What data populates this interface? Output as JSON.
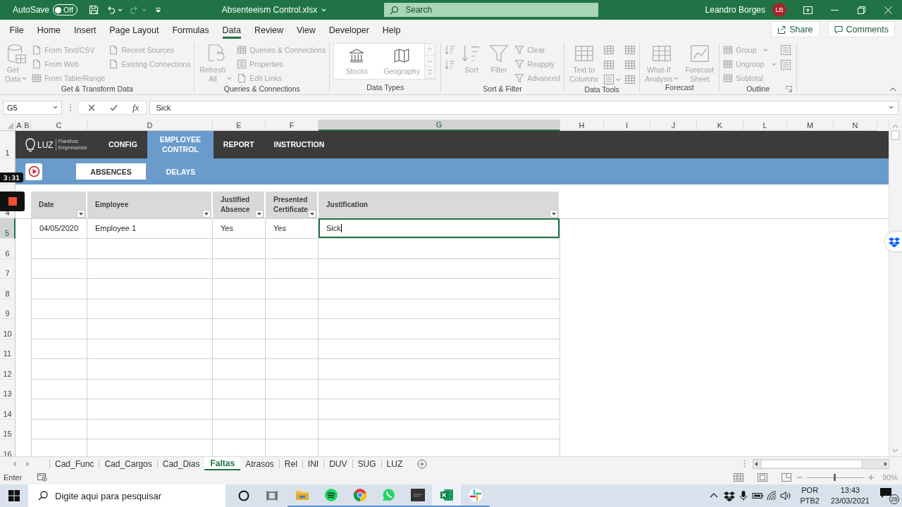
{
  "title_bar": {
    "autosave": {
      "label": "AutoSave",
      "state_text": "Off",
      "on": false
    },
    "file_name": "Absenteeism Control.xlsx",
    "search": {
      "placeholder": "Search"
    },
    "user": {
      "name": "Leandro Borges",
      "initials": "LB"
    }
  },
  "ribbon_tabs": [
    {
      "label": "File",
      "selected": false
    },
    {
      "label": "Home",
      "selected": false
    },
    {
      "label": "Insert",
      "selected": false
    },
    {
      "label": "Page Layout",
      "selected": false
    },
    {
      "label": "Formulas",
      "selected": false
    },
    {
      "label": "Data",
      "selected": true
    },
    {
      "label": "Review",
      "selected": false
    },
    {
      "label": "View",
      "selected": false
    },
    {
      "label": "Developer",
      "selected": false
    },
    {
      "label": "Help",
      "selected": false
    }
  ],
  "share_button": "Share",
  "comments_button": "Comments",
  "ribbon_groups": [
    {
      "label": "Get & Transform Data",
      "columns": [
        {
          "kind": "large",
          "items": [
            {
              "label": "Get\nData",
              "dropdown": true,
              "disabled": true
            }
          ]
        },
        {
          "kind": "small",
          "items": [
            {
              "label": "From Text/CSV",
              "disabled": true
            },
            {
              "label": "From Web",
              "disabled": true
            },
            {
              "label": "From Table/Range",
              "disabled": true
            }
          ]
        },
        {
          "kind": "small",
          "items": [
            {
              "label": "Recent Sources",
              "disabled": true
            },
            {
              "label": "Existing Connections",
              "disabled": true
            }
          ]
        }
      ]
    },
    {
      "label": "Queries & Connections",
      "columns": [
        {
          "kind": "large",
          "items": [
            {
              "label": "Refresh\nAll",
              "dropdown": true,
              "disabled": true
            }
          ]
        },
        {
          "kind": "small",
          "items": [
            {
              "label": "Queries & Connections",
              "disabled": true
            },
            {
              "label": "Properties",
              "disabled": true
            },
            {
              "label": "Edit Links",
              "disabled": true
            }
          ]
        }
      ]
    },
    {
      "label": "Data Types",
      "columns": [
        {
          "kind": "gallery",
          "items": [
            {
              "label": "Stocks",
              "disabled": true
            },
            {
              "label": "Geography",
              "disabled": true
            }
          ]
        }
      ]
    },
    {
      "label": "Sort & Filter",
      "columns": [
        {
          "kind": "icons",
          "items": [
            {
              "disabled": true
            },
            {
              "disabled": true
            }
          ]
        },
        {
          "kind": "large",
          "items": [
            {
              "label": "Sort",
              "disabled": true
            }
          ]
        },
        {
          "kind": "large",
          "items": [
            {
              "label": "Filter",
              "disabled": true
            }
          ]
        },
        {
          "kind": "small",
          "items": [
            {
              "label": "Clear",
              "disabled": true
            },
            {
              "label": "Reapply",
              "disabled": true
            },
            {
              "label": "Advanced",
              "disabled": true
            }
          ]
        }
      ]
    },
    {
      "label": "Data Tools",
      "columns": [
        {
          "kind": "large",
          "items": [
            {
              "label": "Text to\nColumns",
              "disabled": true
            }
          ]
        },
        {
          "kind": "icons",
          "items": [
            {
              "disabled": true
            },
            {
              "disabled": true
            },
            {
              "disabled": true,
              "dropdown": true
            }
          ]
        },
        {
          "kind": "icons",
          "items": [
            {
              "disabled": true
            },
            {
              "disabled": true
            },
            {
              "disabled": true
            }
          ]
        }
      ]
    },
    {
      "label": "Forecast",
      "columns": [
        {
          "kind": "large",
          "items": [
            {
              "label": "What-If\nAnalysis",
              "dropdown": true,
              "disabled": true
            }
          ]
        },
        {
          "kind": "large",
          "items": [
            {
              "label": "Forecast\nSheet",
              "disabled": true
            }
          ]
        }
      ]
    },
    {
      "label": "Outline",
      "launcher": true,
      "columns": [
        {
          "kind": "small",
          "items": [
            {
              "label": "Group",
              "dropdown": true,
              "disabled": true
            },
            {
              "label": "Ungroup",
              "dropdown": true,
              "disabled": true
            },
            {
              "label": "Subtotal",
              "disabled": true
            }
          ]
        },
        {
          "kind": "icons",
          "items": [
            {
              "disabled": true
            },
            {
              "disabled": true
            }
          ]
        }
      ]
    }
  ],
  "formula_bar": {
    "name_box": "G5",
    "function_label": "fx",
    "value": "Sick"
  },
  "sheet": {
    "column_headers": [
      {
        "label": "A",
        "selected": false
      },
      {
        "label": "B",
        "selected": false
      },
      {
        "label": "C",
        "selected": false
      },
      {
        "label": "D",
        "selected": false
      },
      {
        "label": "E",
        "selected": false
      },
      {
        "label": "F",
        "selected": false
      },
      {
        "label": "G",
        "selected": true
      },
      {
        "label": "H",
        "selected": false
      },
      {
        "label": "I",
        "selected": false
      },
      {
        "label": "J",
        "selected": false
      },
      {
        "label": "K",
        "selected": false
      },
      {
        "label": "L",
        "selected": false
      },
      {
        "label": "M",
        "selected": false
      },
      {
        "label": "N",
        "selected": false
      }
    ],
    "row_headers": [
      {
        "label": "1",
        "selected": false
      },
      {
        "selected": false
      },
      {
        "selected": false
      },
      {
        "label": "4",
        "selected": false
      },
      {
        "label": "5",
        "selected": true
      },
      {
        "label": "6",
        "selected": false
      },
      {
        "label": "7",
        "selected": false
      },
      {
        "label": "8",
        "selected": false
      },
      {
        "label": "9",
        "selected": false
      },
      {
        "label": "10",
        "selected": false
      },
      {
        "label": "11",
        "selected": false
      },
      {
        "label": "12",
        "selected": false
      },
      {
        "label": "13",
        "selected": false
      },
      {
        "label": "14",
        "selected": false
      },
      {
        "label": "15",
        "selected": false
      },
      {
        "label": "16",
        "selected": false
      }
    ],
    "banner": {
      "logo": "LUZ",
      "logo_tagline": "Planilhas Empresariais",
      "nav": [
        {
          "label": "CONFIG",
          "selected": false
        },
        {
          "label": "EMPLOYEE CONTROL",
          "selected": true
        },
        {
          "label": "REPORT",
          "selected": false
        },
        {
          "label": "INSTRUCTION",
          "selected": false
        }
      ],
      "sub_tabs": [
        {
          "label": "ABSENCES",
          "selected": true
        },
        {
          "label": "DELAYS",
          "selected": false
        }
      ]
    },
    "table": {
      "columns": [
        {
          "label": "Date"
        },
        {
          "label": "Employee"
        },
        {
          "label": "Justified Absence"
        },
        {
          "label": "Presented Certificate"
        },
        {
          "label": "Justification"
        }
      ],
      "rows": [
        {
          "cells": [
            {
              "text": "04/05/2020",
              "selected": false
            },
            {
              "text": "Employee 1",
              "selected": false
            },
            {
              "text": "Yes",
              "selected": false
            },
            {
              "text": "Yes",
              "selected": false
            },
            {
              "text": "Sick",
              "selected": true
            }
          ]
        }
      ]
    }
  },
  "sheet_tabs": [
    {
      "label": "Cad_Func",
      "selected": false
    },
    {
      "label": "Cad_Cargos",
      "selected": false
    },
    {
      "label": "Cad_Dias",
      "selected": false
    },
    {
      "label": "Faltas",
      "selected": true
    },
    {
      "label": "Atrasos",
      "selected": false
    },
    {
      "label": "Rel",
      "selected": false
    },
    {
      "label": "INI",
      "selected": false
    },
    {
      "label": "DUV",
      "selected": false
    },
    {
      "label": "SUG",
      "selected": false
    },
    {
      "label": "LUZ",
      "selected": false
    }
  ],
  "status_bar": {
    "mode": "Enter",
    "zoom_slider": {
      "level": 0.48
    },
    "zoom_text": "90%"
  },
  "taskbar": {
    "search": {
      "placeholder": "Digite aqui para pesquisar"
    },
    "apps": [
      {
        "running": true,
        "active": false
      },
      {
        "running": true,
        "active": false
      },
      {
        "running": true,
        "active": false
      },
      {
        "running": true,
        "active": false
      },
      {
        "running": true,
        "active": false
      },
      {
        "running": true,
        "active": true
      },
      {
        "running": true,
        "active": false
      }
    ],
    "language": "POR",
    "layout": "PTB2",
    "time": "13:43",
    "date": "23/03/2021",
    "notifications": "28"
  },
  "recorder": {
    "elapsed": "3:31"
  }
}
